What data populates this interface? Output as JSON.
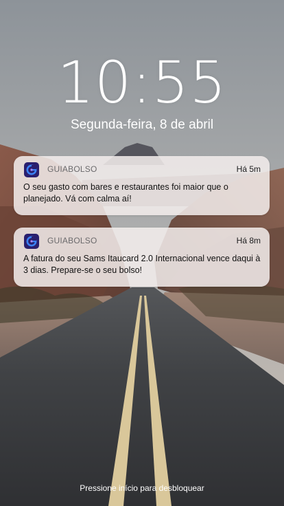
{
  "lockscreen": {
    "time": "10:55",
    "date": "Segunda-feira, 8 de abril",
    "unlock_hint": "Pressione início para desbloquear"
  },
  "notifications": [
    {
      "app_name": "GUIABOLSO",
      "time": "Há 5m",
      "message": "O seu gasto com bares e restaurantes foi maior que o planejado. Vá com calma aí!",
      "icon": "guiabolso-app-icon"
    },
    {
      "app_name": "GUIABOLSO",
      "time": "Há 8m",
      "message": "A fatura do seu Sams Itaucard 2.0 Internacional vence daqui à 3 dias. Prepare-se o seu bolso!",
      "icon": "guiabolso-app-icon"
    }
  ],
  "colors": {
    "app_icon_bg": "#2a1f6e",
    "app_icon_ring": "#3b82f6",
    "notification_bg": "#f3eeec"
  }
}
